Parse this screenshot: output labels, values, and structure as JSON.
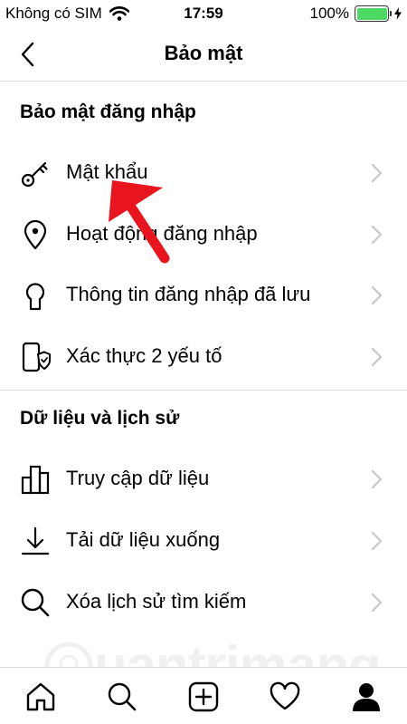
{
  "status": {
    "carrier": "Không có SIM",
    "time": "17:59",
    "battery": "100%",
    "battery_level": 1.0
  },
  "header": {
    "title": "Bảo mật"
  },
  "sections": [
    {
      "title": "Bảo mật đăng nhập",
      "items": [
        {
          "label": "Mật khẩu",
          "icon": "key-icon"
        },
        {
          "label": "Hoạt động đăng nhập",
          "icon": "location-pin-icon"
        },
        {
          "label": "Thông tin đăng nhập đã lưu",
          "icon": "keyhole-icon"
        },
        {
          "label": "Xác thực 2 yếu tố",
          "icon": "phone-shield-icon"
        }
      ]
    },
    {
      "title": "Dữ liệu và lịch sử",
      "items": [
        {
          "label": "Truy cập dữ liệu",
          "icon": "bar-chart-icon"
        },
        {
          "label": "Tải dữ liệu xuống",
          "icon": "download-icon"
        },
        {
          "label": "Xóa lịch sử tìm kiếm",
          "icon": "search-icon"
        }
      ]
    }
  ],
  "watermark": {
    "text": "uantrimang"
  },
  "tabbar": {
    "items": [
      "home-icon",
      "search-icon",
      "add-icon",
      "heart-icon",
      "profile-icon"
    ]
  },
  "colors": {
    "arrow": "#e8141e",
    "battery": "#4cd964",
    "divider": "#dbdbdb",
    "chevron": "#c7c7cc"
  }
}
